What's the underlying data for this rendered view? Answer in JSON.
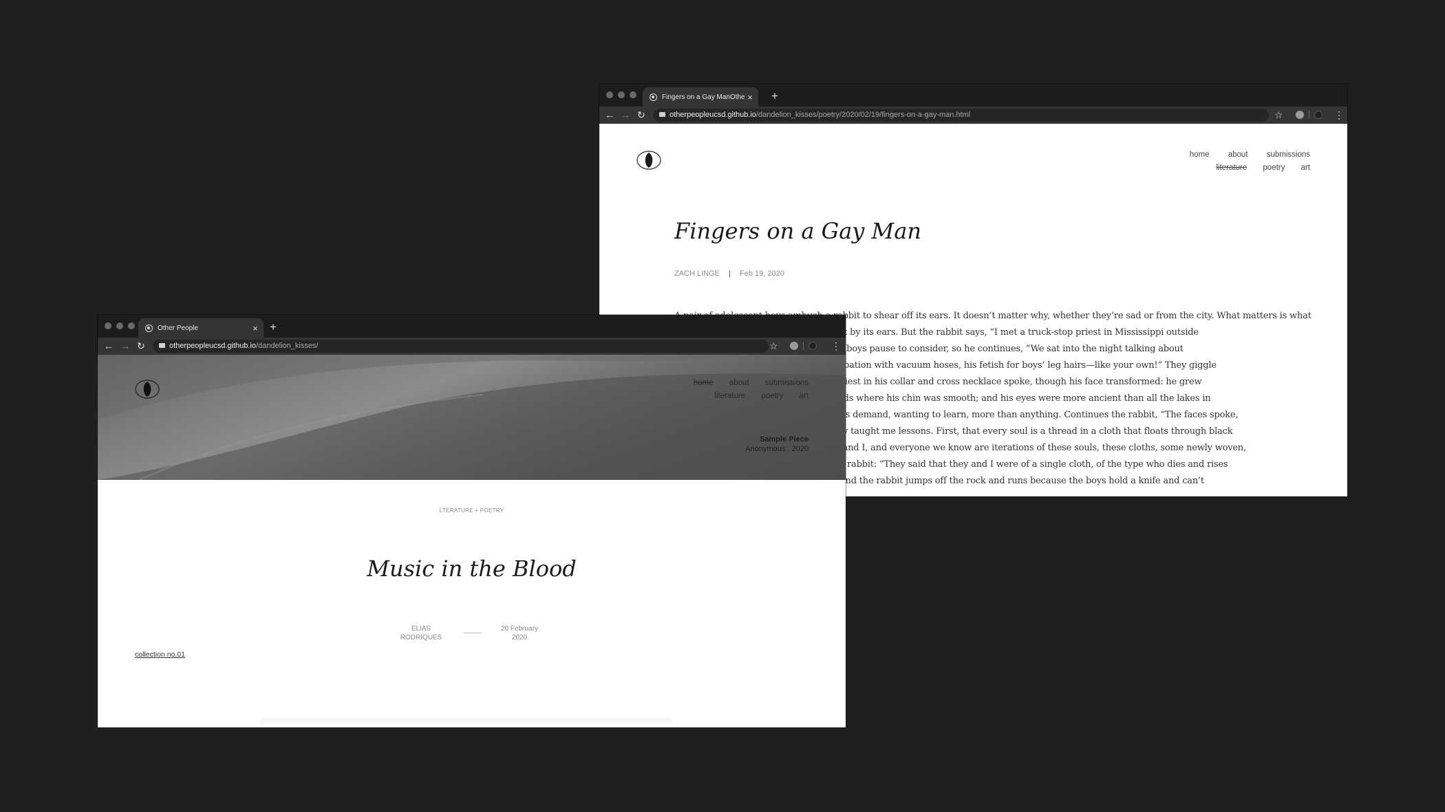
{
  "win1": {
    "tab_title": "Fingers on a Gay ManOther People",
    "url_host": "otherpeopleucsd.github.io",
    "url_path": "/dandelion_kisses/poetry/2020/02/19/fingers-on-a-gay-man.html",
    "nav_row1": [
      "home",
      "about",
      "submissions"
    ],
    "nav_row2": [
      "literature",
      "poetry",
      "art"
    ],
    "title": "Fingers on a Gay Man",
    "author": "ZACH LINGE",
    "divider": "|",
    "date": "Feb 19, 2020",
    "body_lines": [
      "A pair of adolescent boys ambush a rabbit to shear off its ears. It doesn’t matter why, whether they’re sad or from the city. What matters is what",
      "happens next: the boys hang the rabbit by its ears. But the rabbit says, “I met a truck-stop priest in Mississippi outside",
      "Jackson. Know what he said?” And the boys pause to consider, so he continues, “We sat into the night talking about",
      "his obsessions with witchcraft, masturbation with vacuum hoses, his fetish for boys’ leg hairs—like your own!” They giggle",
      "and, confused, stop and listen. “The priest in his collar and cross necklace spoke, though his face transformed: he grew",
      "hair where he had none, he grew beards where his chin was smooth; and his eyes were more ancient than all the lakes in",
      "the world.” What did they say? the boys demand, wanting to learn, more than anything. Continues the rabbit, “The faces spoke,",
      "directly and plainly into my brain. They taught me lessons. First, that every soul is a thread in a cloth that floats through black",
      "space, some old, some whole. So you, and I, and everyone we know are iterations of these souls, these cloths, some newly woven,",
      "and then? What did the faces say? The rabbit: “They said that they and I were of a single cloth, of the type who dies and rises",
      "again.” What else? demand the boys, and the rabbit jumps off the rock and runs because the boys hold a knife and can’t"
    ]
  },
  "win2": {
    "tab_title": "Other People",
    "url_host": "otherpeopleucsd.github.io",
    "url_path": "/dandelion_kisses/",
    "nav_row1": [
      "home",
      "about",
      "submissions"
    ],
    "nav_row2": [
      "literature",
      "poetry",
      "art"
    ],
    "hero_caption_title": "Sample Piece",
    "hero_caption_sub": "Anonymous , 2020",
    "category": "LTERATURE + POETRY",
    "title": "Music in the Blood",
    "author_line1": "ELIAS",
    "author_line2": "RODRIQUES",
    "date_line1": "20 February",
    "date_line2": "2020",
    "collection_link": "collection no.01"
  },
  "colors": {
    "background": "#1f1f1f",
    "tabbar": "#1c1c1c",
    "toolbar": "#353535",
    "muted_text": "#8a8a8a",
    "nav_text": "#555555"
  }
}
